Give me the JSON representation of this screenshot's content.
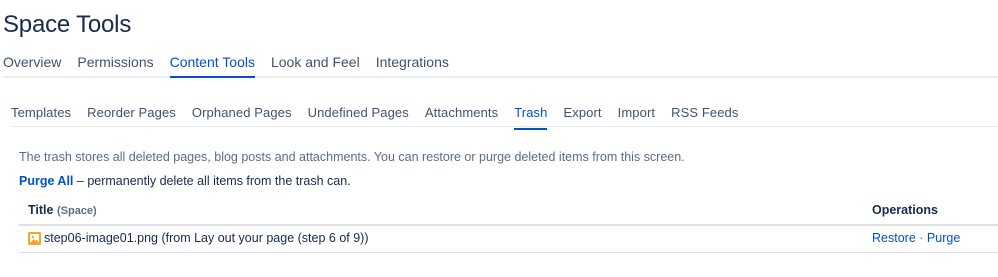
{
  "header": {
    "title": "Space Tools"
  },
  "primary_tabs": [
    {
      "label": "Overview",
      "active": false
    },
    {
      "label": "Permissions",
      "active": false
    },
    {
      "label": "Content Tools",
      "active": true
    },
    {
      "label": "Look and Feel",
      "active": false
    },
    {
      "label": "Integrations",
      "active": false
    }
  ],
  "secondary_tabs": [
    {
      "label": "Templates",
      "active": false
    },
    {
      "label": "Reorder Pages",
      "active": false
    },
    {
      "label": "Orphaned Pages",
      "active": false
    },
    {
      "label": "Undefined Pages",
      "active": false
    },
    {
      "label": "Attachments",
      "active": false
    },
    {
      "label": "Trash",
      "active": true
    },
    {
      "label": "Export",
      "active": false
    },
    {
      "label": "Import",
      "active": false
    },
    {
      "label": "RSS Feeds",
      "active": false
    }
  ],
  "trash": {
    "description": "The trash stores all deleted pages, blog posts and attachments. You can restore or purge deleted items from this screen.",
    "purge_all_label": "Purge All",
    "purge_all_text": " – permanently delete all items from the trash can.",
    "columns": {
      "title": "Title",
      "space": "(Space)",
      "operations": "Operations"
    },
    "rows": [
      {
        "icon": "image-file-icon",
        "title": "step06-image01.png (from Lay out your page (step 6 of 9))",
        "restore_label": "Restore",
        "separator": "·",
        "purge_label": "Purge"
      }
    ]
  },
  "colors": {
    "accent": "#0052CC",
    "text": "#172B4D",
    "muted": "#5E6C84",
    "icon": "#F5A623"
  }
}
